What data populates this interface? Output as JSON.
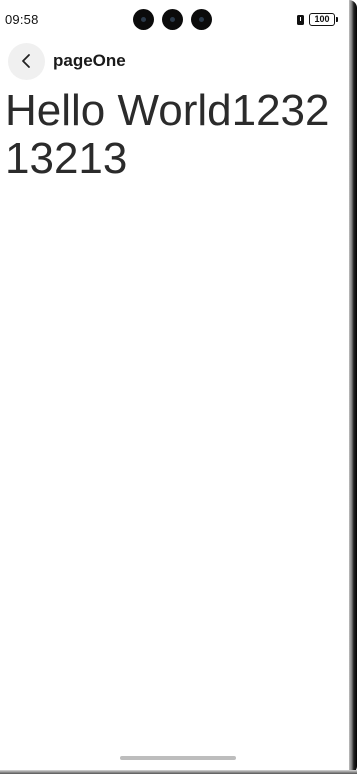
{
  "status_bar": {
    "time": "09:58",
    "battery": "100"
  },
  "header": {
    "title": "pageOne",
    "back_icon": "chevron-left-icon"
  },
  "main": {
    "text": "Hello World123213213"
  },
  "colors": {
    "background": "#ffffff",
    "text": "#2b2b2b",
    "back_button_bg": "#f0f0f0",
    "home_indicator": "#bdbdbd"
  }
}
